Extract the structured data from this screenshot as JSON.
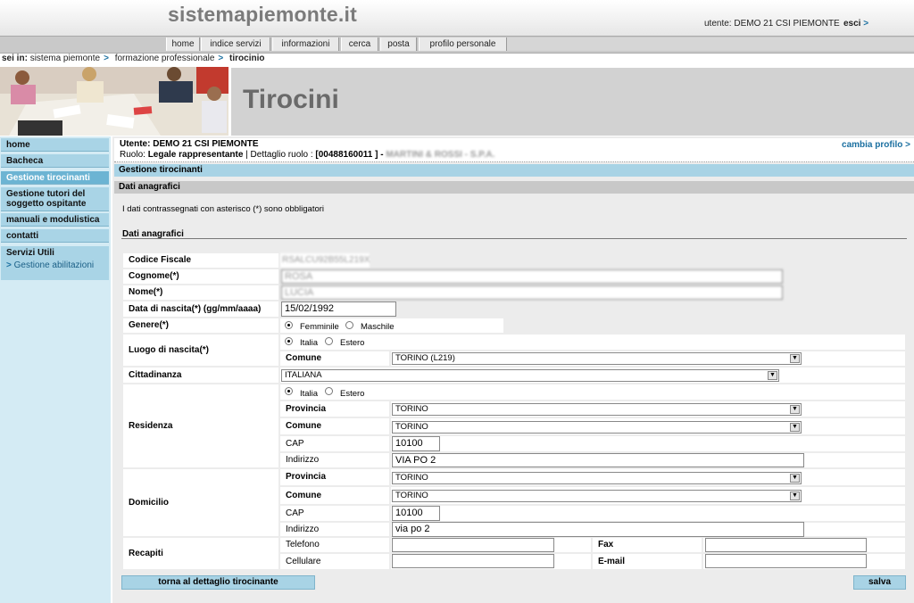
{
  "header": {
    "logo": "sistemapiemonte.it",
    "user_label": "utente:",
    "user_name": "DEMO 21 CSI PIEMONTE",
    "logout_label": "esci",
    "logout_arrow": ">"
  },
  "menu": {
    "items": [
      "home",
      "indice servizi",
      "informazioni",
      "cerca",
      "posta",
      "profilo personale"
    ]
  },
  "breadcrumb": {
    "prefix": "sei in:",
    "items": [
      "sistema piemonte",
      "formazione professionale",
      "tirocinio"
    ],
    "sep": ">"
  },
  "banner": {
    "title": "Tirocini"
  },
  "sidebar": {
    "items": [
      "home",
      "Bacheca",
      "Gestione tirocinanti",
      "Gestione tutori del soggetto ospitante",
      "manuali e modulistica",
      "contatti"
    ],
    "util_title": "Servizi Utili",
    "util_item": "Gestione abilitazioni",
    "util_arrow": ">"
  },
  "userbox": {
    "line1": "Utente: DEMO 21 CSI PIEMONTE",
    "line2_prefix": "Ruolo: ",
    "role": "Legale rappresentante",
    "detail_label": " | Dettaglio ruolo : ",
    "detail_value": "[00488160011 ] - ",
    "company": "MARTINI & ROSSI - S.P.A.",
    "change_profile": "cambia profilo >"
  },
  "sections": {
    "s1": "Gestione tirocinanti",
    "s2": "Dati anagrafici",
    "note": "I dati contrassegnati con asterisco (*) sono obbligatori",
    "subtitle": "Dati anagrafici"
  },
  "form": {
    "codice_fiscale_label": "Codice Fiscale",
    "codice_fiscale_value": "RSALCU92B55L219X",
    "cognome_label": "Cognome(*)",
    "cognome_value": "ROSA",
    "nome_label": "Nome(*)",
    "nome_value": "LUCIA",
    "data_label": "Data di nascita(*) (gg/mm/aaaa)",
    "data_value": "15/02/1992",
    "genere_label": "Genere(*)",
    "genere_f": "Femminile",
    "genere_m": "Maschile",
    "luogo_label": "Luogo di nascita(*)",
    "italia": "Italia",
    "estero": "Estero",
    "comune_label": "Comune",
    "comune_nascita": "TORINO (L219)",
    "cittadinanza_label": "Cittadinanza",
    "cittadinanza_value": "ITALIANA",
    "residenza_label": "Residenza",
    "provincia_label": "Provincia",
    "res_provincia": "TORINO",
    "res_comune": "TORINO",
    "cap_label": "CAP",
    "res_cap": "10100",
    "indirizzo_label": "Indirizzo",
    "res_indirizzo": "VIA PO 2",
    "domicilio_label": "Domicilio",
    "dom_provincia": "TORINO",
    "dom_comune": "TORINO",
    "dom_cap": "10100",
    "dom_indirizzo": "via po 2",
    "recapiti_label": "Recapiti",
    "telefono_label": "Telefono",
    "cellulare_label": "Cellulare",
    "fax_label": "Fax",
    "email_label": "E-mail"
  },
  "buttons": {
    "back": "torna al dettaglio tirocinante",
    "save": "salva"
  },
  "colors": {
    "accent": "#a8d3e5",
    "sidebar_bg": "#d4ebf4",
    "link": "#1a6fa0"
  }
}
